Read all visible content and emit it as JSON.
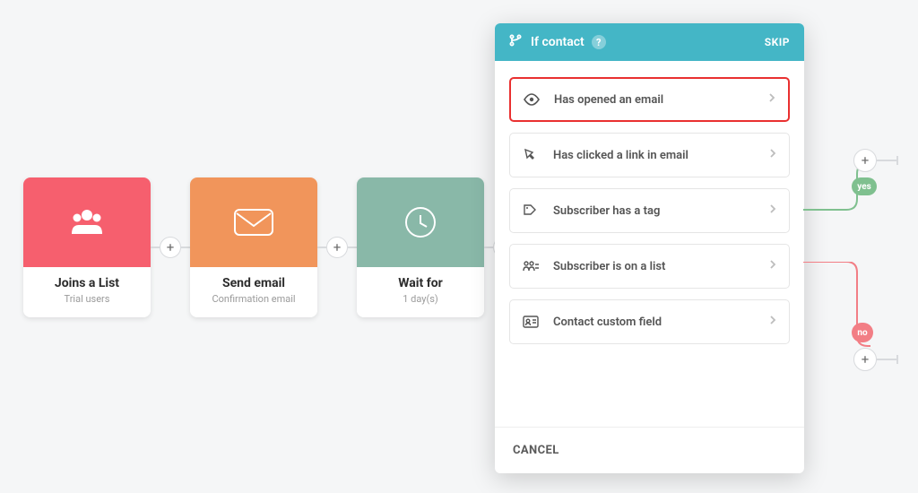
{
  "flow": {
    "cards": [
      {
        "title": "Joins a List",
        "sub": "Trial users"
      },
      {
        "title": "Send email",
        "sub": "Confirmation email"
      },
      {
        "title": "Wait for",
        "sub": "1 day(s)"
      }
    ]
  },
  "modal": {
    "header_title": "If contact",
    "skip_label": "SKIP",
    "options": [
      {
        "label": "Has opened an email"
      },
      {
        "label": "Has clicked a link in email"
      },
      {
        "label": "Subscriber has a tag"
      },
      {
        "label": "Subscriber is on a list"
      },
      {
        "label": "Contact custom field"
      }
    ],
    "cancel_label": "CANCEL"
  },
  "branch": {
    "yes_label": "yes",
    "no_label": "no"
  }
}
